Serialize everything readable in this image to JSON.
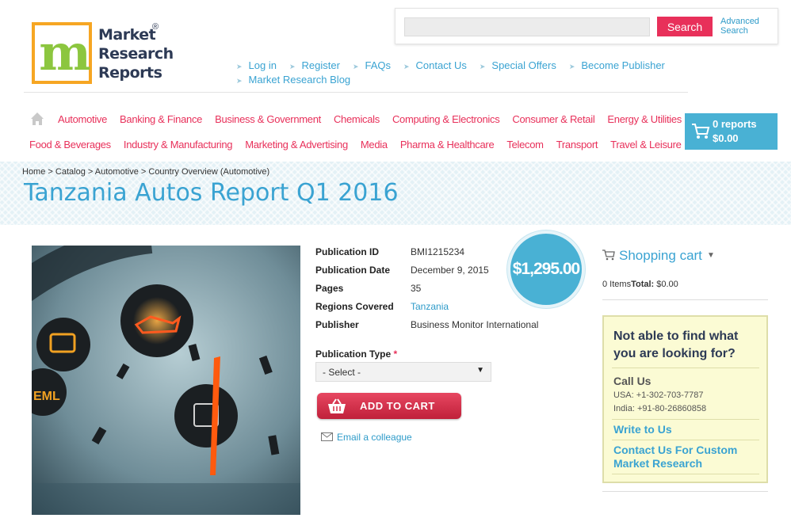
{
  "logo": {
    "line1": "Market",
    "line2": "Research",
    "line3": "Reports",
    "reg": "®",
    "mark": "m"
  },
  "search": {
    "placeholder": "",
    "button_label": "Search",
    "advanced_line1": "Advanced",
    "advanced_line2": "Search"
  },
  "top_nav": [
    "Log in",
    "Register",
    "FAQs",
    "Contact Us",
    "Special Offers",
    "Become Publisher",
    "Market Research Blog"
  ],
  "categories_row1": [
    "Automotive",
    "Banking & Finance",
    "Business & Government",
    "Chemicals",
    "Computing & Electronics",
    "Consumer & Retail",
    "Energy & Utilities"
  ],
  "categories_row2": [
    "Food & Beverages",
    "Industry & Manufacturing",
    "Marketing & Advertising",
    "Media",
    "Pharma & Healthcare",
    "Telecom",
    "Transport",
    "Travel & Leisure"
  ],
  "cart": {
    "count": "0 reports",
    "total": "$0.00"
  },
  "breadcrumb": [
    "Home",
    "Catalog",
    "Automotive",
    "Country Overview (Automotive)"
  ],
  "breadcrumb_sep": ">",
  "page_title": "Tanzania Autos Report Q1 2016",
  "details": [
    {
      "label": "Publication ID",
      "value": "BMI1215234",
      "link": false
    },
    {
      "label": "Publication Date",
      "value": "December 9, 2015",
      "link": false
    },
    {
      "label": "Pages",
      "value": "35",
      "link": false
    },
    {
      "label": "Regions Covered",
      "value": "Tanzania",
      "link": true
    },
    {
      "label": "Publisher",
      "value": "Business Monitor International",
      "link": false
    }
  ],
  "price": "$1,295.00",
  "pub_type": {
    "label": "Publication Type",
    "required": "*",
    "selected": "- Select -"
  },
  "add_to_cart": "ADD TO CART",
  "email_colleague": "Email a colleague",
  "shopping_cart": {
    "title": "Shopping cart",
    "items": "0 Items",
    "total_label": "Total:",
    "total_value": "$0.00"
  },
  "help": {
    "title": "Not able to find what you are looking for?",
    "call_us": "Call Us",
    "usa": "USA: +1-302-703-7787",
    "india": "India: +91-80-26860858",
    "write_us": "Write to Us",
    "contact_custom": "Contact Us For Custom Market Research"
  },
  "colors": {
    "accent_blue": "#3aa3d2",
    "accent_pink": "#e8305a",
    "logo_orange": "#f6a623",
    "logo_green": "#8cc63f"
  }
}
